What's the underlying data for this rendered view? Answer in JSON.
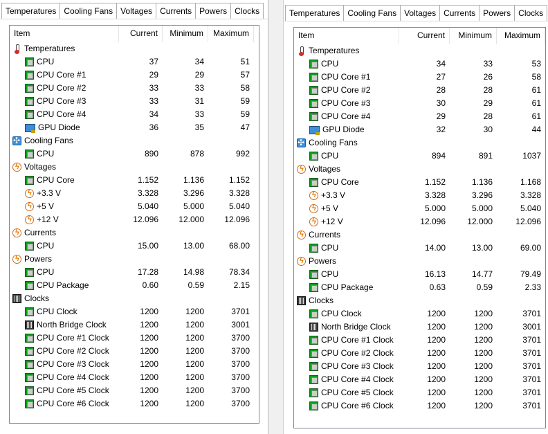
{
  "tabs": [
    "Temperatures",
    "Cooling Fans",
    "Voltages",
    "Currents",
    "Powers",
    "Clocks"
  ],
  "columns": {
    "item": "Item",
    "current": "Current",
    "minimum": "Minimum",
    "maximum": "Maximum"
  },
  "left": {
    "rows": [
      {
        "kind": "group",
        "icon": "thermometer-icon",
        "label": "Temperatures"
      },
      {
        "kind": "sensor",
        "icon": "cpu-chip-icon",
        "label": "CPU",
        "cur": "37",
        "min": "34",
        "max": "51"
      },
      {
        "kind": "sensor",
        "icon": "cpu-chip-icon",
        "label": "CPU Core #1",
        "cur": "29",
        "min": "29",
        "max": "57"
      },
      {
        "kind": "sensor",
        "icon": "cpu-chip-icon",
        "label": "CPU Core #2",
        "cur": "33",
        "min": "33",
        "max": "58"
      },
      {
        "kind": "sensor",
        "icon": "cpu-chip-icon",
        "label": "CPU Core #3",
        "cur": "33",
        "min": "31",
        "max": "59"
      },
      {
        "kind": "sensor",
        "icon": "cpu-chip-icon",
        "label": "CPU Core #4",
        "cur": "34",
        "min": "33",
        "max": "59"
      },
      {
        "kind": "sensor",
        "icon": "gpu-icon",
        "label": "GPU Diode",
        "cur": "36",
        "min": "35",
        "max": "47"
      },
      {
        "kind": "group",
        "icon": "fan-icon",
        "label": "Cooling Fans"
      },
      {
        "kind": "sensor",
        "icon": "cpu-chip-icon",
        "label": "CPU",
        "cur": "890",
        "min": "878",
        "max": "992"
      },
      {
        "kind": "group",
        "icon": "bolt-icon",
        "label": "Voltages"
      },
      {
        "kind": "sensor",
        "icon": "cpu-chip-icon",
        "label": "CPU Core",
        "cur": "1.152",
        "min": "1.136",
        "max": "1.152"
      },
      {
        "kind": "sensor",
        "icon": "bolt-icon",
        "label": "+3.3 V",
        "cur": "3.328",
        "min": "3.296",
        "max": "3.328"
      },
      {
        "kind": "sensor",
        "icon": "bolt-icon",
        "label": "+5 V",
        "cur": "5.040",
        "min": "5.000",
        "max": "5.040"
      },
      {
        "kind": "sensor",
        "icon": "bolt-icon",
        "label": "+12 V",
        "cur": "12.096",
        "min": "12.000",
        "max": "12.096"
      },
      {
        "kind": "group",
        "icon": "bolt-icon",
        "label": "Currents"
      },
      {
        "kind": "sensor",
        "icon": "cpu-chip-icon",
        "label": "CPU",
        "cur": "15.00",
        "min": "13.00",
        "max": "68.00"
      },
      {
        "kind": "group",
        "icon": "bolt-icon",
        "label": "Powers"
      },
      {
        "kind": "sensor",
        "icon": "cpu-chip-icon",
        "label": "CPU",
        "cur": "17.28",
        "min": "14.98",
        "max": "78.34"
      },
      {
        "kind": "sensor",
        "icon": "cpu-chip-icon",
        "label": "CPU Package",
        "cur": "0.60",
        "min": "0.59",
        "max": "2.15"
      },
      {
        "kind": "group",
        "icon": "clock-chip-icon",
        "label": "Clocks"
      },
      {
        "kind": "sensor",
        "icon": "cpu-chip-icon",
        "label": "CPU Clock",
        "cur": "1200",
        "min": "1200",
        "max": "3701"
      },
      {
        "kind": "sensor",
        "icon": "clock-chip-icon",
        "label": "North Bridge Clock",
        "cur": "1200",
        "min": "1200",
        "max": "3001"
      },
      {
        "kind": "sensor",
        "icon": "cpu-chip-icon",
        "label": "CPU Core #1 Clock",
        "cur": "1200",
        "min": "1200",
        "max": "3700"
      },
      {
        "kind": "sensor",
        "icon": "cpu-chip-icon",
        "label": "CPU Core #2 Clock",
        "cur": "1200",
        "min": "1200",
        "max": "3700"
      },
      {
        "kind": "sensor",
        "icon": "cpu-chip-icon",
        "label": "CPU Core #3 Clock",
        "cur": "1200",
        "min": "1200",
        "max": "3700"
      },
      {
        "kind": "sensor",
        "icon": "cpu-chip-icon",
        "label": "CPU Core #4 Clock",
        "cur": "1200",
        "min": "1200",
        "max": "3700"
      },
      {
        "kind": "sensor",
        "icon": "cpu-chip-icon",
        "label": "CPU Core #5 Clock",
        "cur": "1200",
        "min": "1200",
        "max": "3700"
      },
      {
        "kind": "sensor",
        "icon": "cpu-chip-icon",
        "label": "CPU Core #6 Clock",
        "cur": "1200",
        "min": "1200",
        "max": "3700"
      }
    ]
  },
  "right": {
    "rows": [
      {
        "kind": "group",
        "icon": "thermometer-icon",
        "label": "Temperatures"
      },
      {
        "kind": "sensor",
        "icon": "cpu-chip-icon",
        "label": "CPU",
        "cur": "34",
        "min": "33",
        "max": "53"
      },
      {
        "kind": "sensor",
        "icon": "cpu-chip-icon",
        "label": "CPU Core #1",
        "cur": "27",
        "min": "26",
        "max": "58"
      },
      {
        "kind": "sensor",
        "icon": "cpu-chip-icon",
        "label": "CPU Core #2",
        "cur": "28",
        "min": "28",
        "max": "61"
      },
      {
        "kind": "sensor",
        "icon": "cpu-chip-icon",
        "label": "CPU Core #3",
        "cur": "30",
        "min": "29",
        "max": "61"
      },
      {
        "kind": "sensor",
        "icon": "cpu-chip-icon",
        "label": "CPU Core #4",
        "cur": "29",
        "min": "28",
        "max": "61"
      },
      {
        "kind": "sensor",
        "icon": "gpu-icon",
        "label": "GPU Diode",
        "cur": "32",
        "min": "30",
        "max": "44"
      },
      {
        "kind": "group",
        "icon": "fan-icon",
        "label": "Cooling Fans"
      },
      {
        "kind": "sensor",
        "icon": "cpu-chip-icon",
        "label": "CPU",
        "cur": "894",
        "min": "891",
        "max": "1037"
      },
      {
        "kind": "group",
        "icon": "bolt-icon",
        "label": "Voltages"
      },
      {
        "kind": "sensor",
        "icon": "cpu-chip-icon",
        "label": "CPU Core",
        "cur": "1.152",
        "min": "1.136",
        "max": "1.168"
      },
      {
        "kind": "sensor",
        "icon": "bolt-icon",
        "label": "+3.3 V",
        "cur": "3.328",
        "min": "3.296",
        "max": "3.328"
      },
      {
        "kind": "sensor",
        "icon": "bolt-icon",
        "label": "+5 V",
        "cur": "5.000",
        "min": "5.000",
        "max": "5.040"
      },
      {
        "kind": "sensor",
        "icon": "bolt-icon",
        "label": "+12 V",
        "cur": "12.096",
        "min": "12.000",
        "max": "12.096"
      },
      {
        "kind": "group",
        "icon": "bolt-icon",
        "label": "Currents"
      },
      {
        "kind": "sensor",
        "icon": "cpu-chip-icon",
        "label": "CPU",
        "cur": "14.00",
        "min": "13.00",
        "max": "69.00"
      },
      {
        "kind": "group",
        "icon": "bolt-icon",
        "label": "Powers"
      },
      {
        "kind": "sensor",
        "icon": "cpu-chip-icon",
        "label": "CPU",
        "cur": "16.13",
        "min": "14.77",
        "max": "79.49"
      },
      {
        "kind": "sensor",
        "icon": "cpu-chip-icon",
        "label": "CPU Package",
        "cur": "0.63",
        "min": "0.59",
        "max": "2.33"
      },
      {
        "kind": "group",
        "icon": "clock-chip-icon",
        "label": "Clocks"
      },
      {
        "kind": "sensor",
        "icon": "cpu-chip-icon",
        "label": "CPU Clock",
        "cur": "1200",
        "min": "1200",
        "max": "3701"
      },
      {
        "kind": "sensor",
        "icon": "clock-chip-icon",
        "label": "North Bridge Clock",
        "cur": "1200",
        "min": "1200",
        "max": "3001"
      },
      {
        "kind": "sensor",
        "icon": "cpu-chip-icon",
        "label": "CPU Core #1 Clock",
        "cur": "1200",
        "min": "1200",
        "max": "3701"
      },
      {
        "kind": "sensor",
        "icon": "cpu-chip-icon",
        "label": "CPU Core #2 Clock",
        "cur": "1200",
        "min": "1200",
        "max": "3701"
      },
      {
        "kind": "sensor",
        "icon": "cpu-chip-icon",
        "label": "CPU Core #3 Clock",
        "cur": "1200",
        "min": "1200",
        "max": "3701"
      },
      {
        "kind": "sensor",
        "icon": "cpu-chip-icon",
        "label": "CPU Core #4 Clock",
        "cur": "1200",
        "min": "1200",
        "max": "3701"
      },
      {
        "kind": "sensor",
        "icon": "cpu-chip-icon",
        "label": "CPU Core #5 Clock",
        "cur": "1200",
        "min": "1200",
        "max": "3701"
      },
      {
        "kind": "sensor",
        "icon": "cpu-chip-icon",
        "label": "CPU Core #6 Clock",
        "cur": "1200",
        "min": "1200",
        "max": "3701"
      }
    ]
  }
}
